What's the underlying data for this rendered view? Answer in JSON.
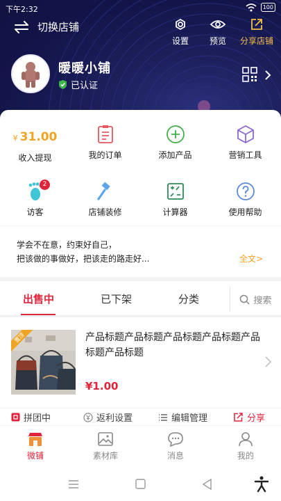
{
  "status_bar": {
    "time": "下午2:32",
    "battery": "100"
  },
  "topbar": {
    "switch_label": "切换店铺",
    "settings_label": "设置",
    "preview_label": "预览",
    "share_label": "分享店铺"
  },
  "profile": {
    "shop_name": "暖暖小铺",
    "verified_label": "已认证"
  },
  "grid": {
    "income_currency": "¥",
    "income_value": "31.00",
    "income_label": "收入提现",
    "orders_label": "我的订单",
    "add_product_label": "添加产品",
    "marketing_label": "营销工具",
    "visitors_label": "访客",
    "visitors_badge": "2",
    "decor_label": "店铺装修",
    "calc_label": "计算器",
    "help_label": "使用帮助"
  },
  "notice": {
    "line1": "学会不在意，约束好自己，",
    "line2": "把该做的事做好，把该走的路走好...",
    "more": "全文>"
  },
  "tabs": {
    "on_sale": "出售中",
    "off_shelf": "已下架",
    "category": "分类",
    "search": "搜索"
  },
  "product": {
    "ribbon": "置顶",
    "title": "产品标题产品标题产品标题产品标题产品标题产品标题",
    "price": "¥1.00",
    "action_group": "拼团中",
    "action_rebate": "返利设置",
    "action_edit": "编辑管理",
    "action_share": "分享"
  },
  "bottom_nav": {
    "shop": "微铺",
    "materials": "素材库",
    "messages": "消息",
    "mine": "我的"
  },
  "colors": {
    "accent": "#e0243a",
    "gold": "#f1a323",
    "header": "#13154a"
  }
}
